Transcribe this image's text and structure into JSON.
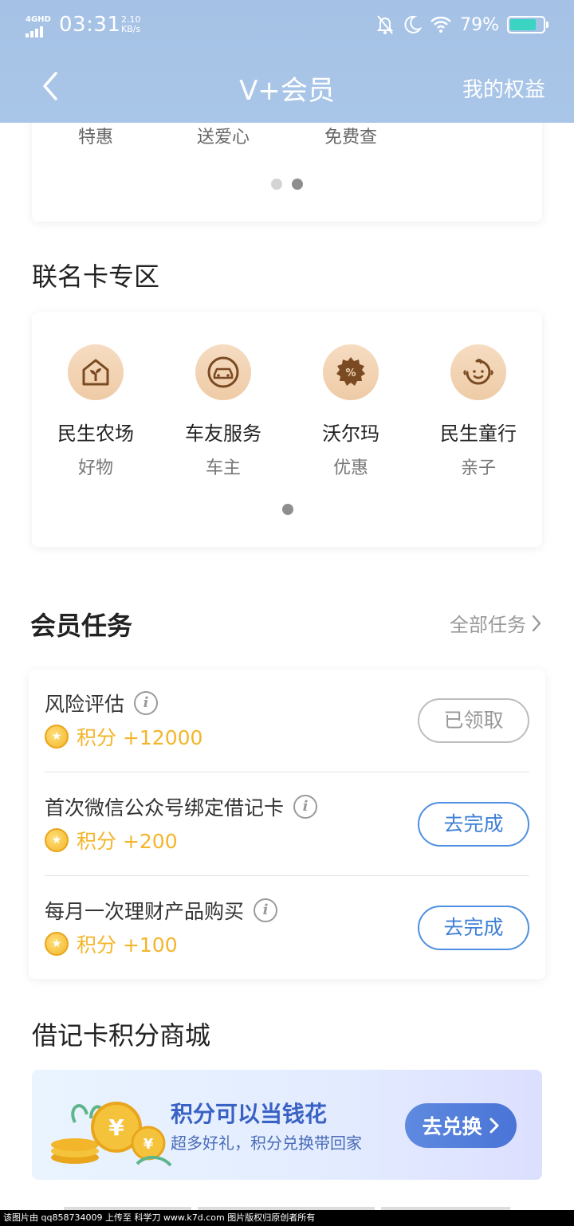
{
  "status": {
    "network": "4GHD",
    "time": "03:31",
    "speed_value": "2.10",
    "speed_unit": "KB/s",
    "battery_pct": "79%",
    "battery_color": "#3bd3c1"
  },
  "nav": {
    "back_icon": "chevron-left-icon",
    "title": "V+会员",
    "right_label": "我的权益"
  },
  "top_card": {
    "labels": [
      "特惠",
      "送爱心",
      "免费查"
    ],
    "active_page": 2,
    "page_count": 2
  },
  "cobrand": {
    "title": "联名卡专区",
    "items": [
      {
        "name": "民生农场",
        "sub": "好物",
        "icon": "house-sprout-icon"
      },
      {
        "name": "车友服务",
        "sub": "车主",
        "icon": "car-icon"
      },
      {
        "name": "沃尔玛",
        "sub": "优惠",
        "icon": "discount-badge-icon"
      },
      {
        "name": "民生童行",
        "sub": "亲子",
        "icon": "baby-face-icon"
      }
    ],
    "page_count": 1
  },
  "tasks": {
    "title": "会员任务",
    "all_label": "全部任务",
    "items": [
      {
        "name": "风险评估",
        "points": "积分 +12000",
        "button": "已领取",
        "state": "done"
      },
      {
        "name": "首次微信公众号绑定借记卡",
        "points": "积分 +200",
        "button": "去完成",
        "state": "todo"
      },
      {
        "name": "每月一次理财产品购买",
        "points": "积分 +100",
        "button": "去完成",
        "state": "todo"
      }
    ]
  },
  "mall": {
    "title": "借记卡积分商城",
    "banner_title": "积分可以当钱花",
    "banner_sub": "超多好礼，积分兑换带回家",
    "banner_button": "去兑换"
  },
  "watermark": "该图片由 qq858734009 上传至 科学刀 www.k7d.com 图片版权归原创者所有",
  "colors": {
    "header": "#a5c2e6",
    "accent_blue": "#3f80d6",
    "points_gold": "#f3b52a"
  }
}
